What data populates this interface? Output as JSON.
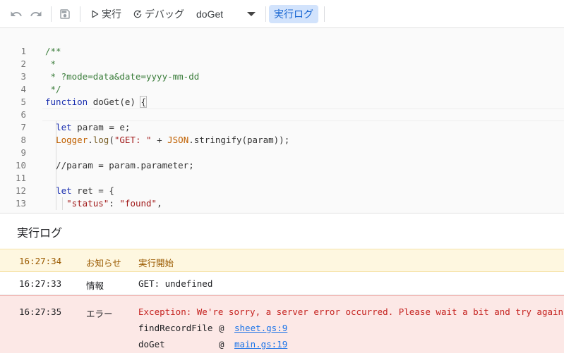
{
  "toolbar": {
    "run_label": "実行",
    "debug_label": "デバッグ",
    "function_name": "doGet",
    "log_label": "実行ログ"
  },
  "editor": {
    "lines": [
      {
        "n": "1",
        "tokens": [
          {
            "t": "/**",
            "c": "cmt"
          }
        ]
      },
      {
        "n": "2",
        "tokens": [
          {
            "t": " *",
            "c": "cmt"
          }
        ]
      },
      {
        "n": "3",
        "tokens": [
          {
            "t": " * ?mode=data&date=yyyy-mm-dd",
            "c": "cmt"
          }
        ]
      },
      {
        "n": "4",
        "tokens": [
          {
            "t": " */",
            "c": "cmt"
          }
        ]
      },
      {
        "n": "5",
        "tokens": [
          {
            "t": "function",
            "c": "kw"
          },
          {
            "t": " doGet(e) ",
            "c": "plain"
          },
          {
            "t": "{",
            "c": "brace"
          }
        ]
      },
      {
        "n": "6",
        "tokens": []
      },
      {
        "n": "7",
        "tokens": [
          {
            "t": "  ",
            "c": "plain"
          },
          {
            "t": "let",
            "c": "kw"
          },
          {
            "t": " param = e;",
            "c": "plain"
          }
        ]
      },
      {
        "n": "8",
        "tokens": [
          {
            "t": "  ",
            "c": "plain"
          },
          {
            "t": "Logger",
            "c": "obj"
          },
          {
            "t": ".",
            "c": "plain"
          },
          {
            "t": "log",
            "c": "fn"
          },
          {
            "t": "(",
            "c": "plain"
          },
          {
            "t": "\"GET: \"",
            "c": "str"
          },
          {
            "t": " + ",
            "c": "plain"
          },
          {
            "t": "JSON",
            "c": "obj"
          },
          {
            "t": ".stringify(param));",
            "c": "plain"
          }
        ]
      },
      {
        "n": "9",
        "tokens": []
      },
      {
        "n": "10",
        "tokens": [
          {
            "t": "  //param = param.parameter;",
            "c": "plain"
          }
        ]
      },
      {
        "n": "11",
        "tokens": []
      },
      {
        "n": "12",
        "tokens": [
          {
            "t": "  ",
            "c": "plain"
          },
          {
            "t": "let",
            "c": "kw"
          },
          {
            "t": " ret = {",
            "c": "plain"
          }
        ]
      },
      {
        "n": "13",
        "tokens": [
          {
            "t": "    ",
            "c": "plain"
          },
          {
            "t": "\"status\"",
            "c": "str"
          },
          {
            "t": ": ",
            "c": "plain"
          },
          {
            "t": "\"found\"",
            "c": "str"
          },
          {
            "t": ",",
            "c": "plain"
          }
        ]
      }
    ]
  },
  "log": {
    "title": "実行ログ",
    "entries": [
      {
        "time": "16:27:34",
        "level": "お知らせ",
        "message": "実行開始"
      },
      {
        "time": "16:27:33",
        "level": "情報",
        "message": "GET: undefined"
      },
      {
        "time": "16:27:35",
        "level": "エラー",
        "message": "Exception: We're sorry, a server error occurred. Please wait a bit and try again.",
        "stack": [
          {
            "func": "findRecordFile",
            "at": "@",
            "location": "sheet.gs:9"
          },
          {
            "func": "doGet",
            "at": "@",
            "location": "main.gs:19"
          }
        ]
      }
    ]
  }
}
